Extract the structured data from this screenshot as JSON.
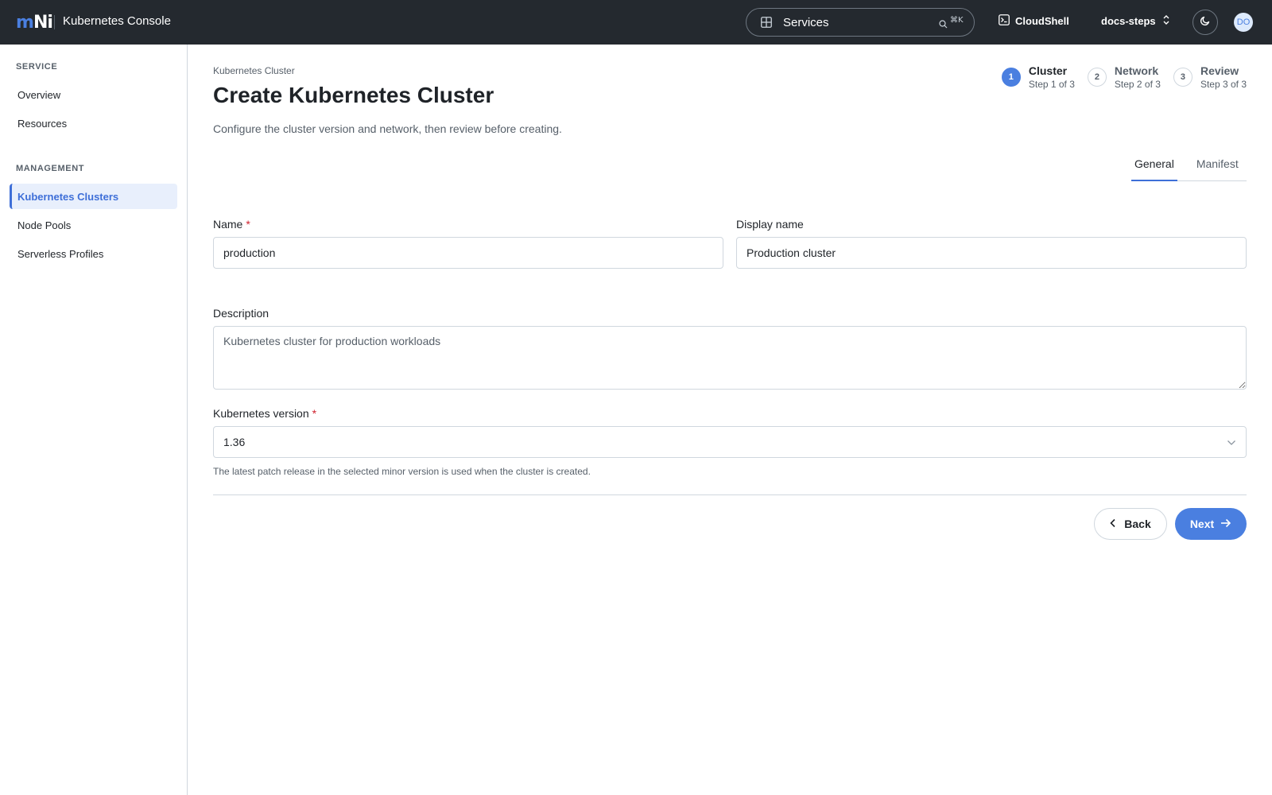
{
  "topbar": {
    "logo_m": "m",
    "logo_ni": "Ni",
    "app_title": "Kubernetes Console",
    "search_text": "Services",
    "search_shortcut": "⌘K",
    "cloudshell_label": "CloudShell",
    "project_label": "docs-steps",
    "avatar_initials": "DO"
  },
  "sidebar": {
    "sections": [
      {
        "heading": "SERVICE",
        "items": [
          "Overview",
          "Resources"
        ]
      },
      {
        "heading": "MANAGEMENT",
        "items": [
          "Kubernetes Clusters",
          "Node Pools",
          "Serverless Profiles"
        ]
      }
    ],
    "active_item": "Kubernetes Clusters"
  },
  "page": {
    "breadcrumb": "Kubernetes Cluster",
    "title": "Create Kubernetes Cluster",
    "description": "Configure the cluster version and network, then review before creating."
  },
  "steps": [
    {
      "num": "1",
      "label": "Cluster",
      "sub": "Step 1 of 3"
    },
    {
      "num": "2",
      "label": "Network",
      "sub": "Step 2 of 3"
    },
    {
      "num": "3",
      "label": "Review",
      "sub": "Step 3 of 3"
    }
  ],
  "current_step": "1",
  "tabs": {
    "general": "General",
    "manifest": "Manifest",
    "active": "General"
  },
  "form": {
    "name_label": "Name",
    "required_mark": "*",
    "name_value": "production",
    "display_name_label": "Display name",
    "display_name_value": "Production cluster",
    "description_label": "Description",
    "description_value": "Kubernetes cluster for production workloads",
    "version_label": "Kubernetes version",
    "version_value": "1.36",
    "version_hint": "The latest patch release in the selected minor version is used when the cluster is created."
  },
  "actions": {
    "back": "Back",
    "next": "Next"
  },
  "colors": {
    "accent": "#4a7fe0",
    "topbar": "#24292f",
    "required": "#cf222e"
  }
}
